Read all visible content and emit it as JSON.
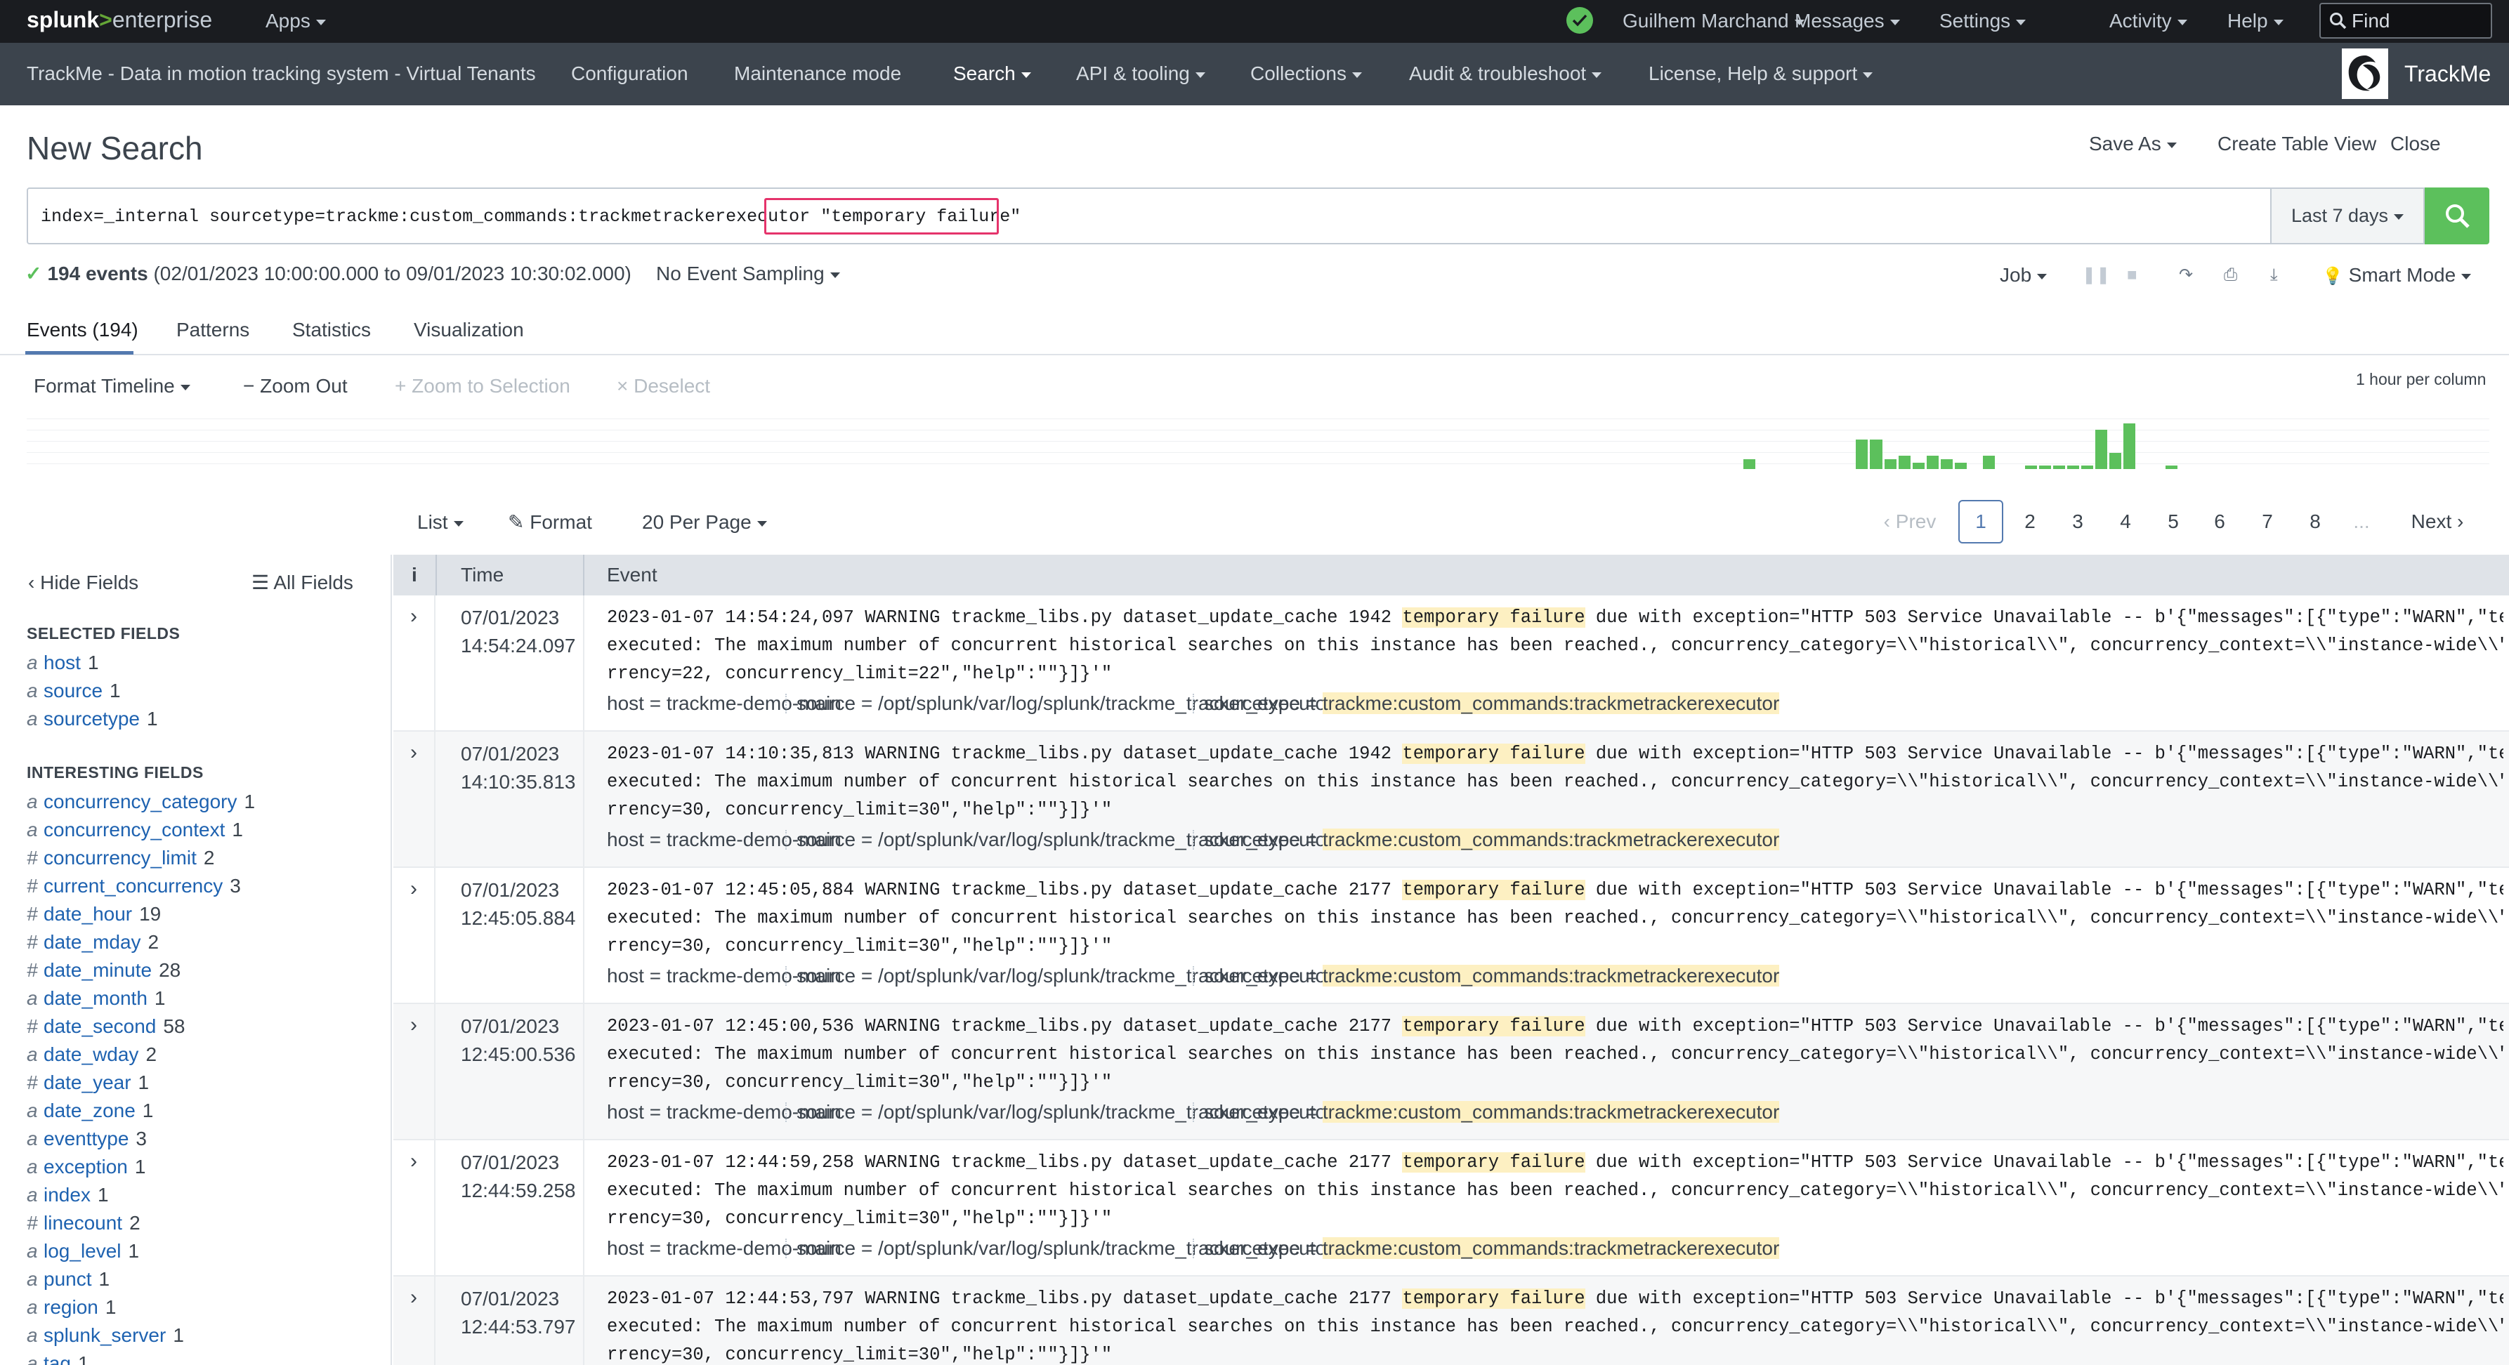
{
  "topbar": {
    "logo_splunk": "splunk",
    "logo_gt": ">",
    "logo_enterprise": "enterprise",
    "apps": "Apps",
    "user": "Guilhem Marchand",
    "messages": "Messages",
    "settings": "Settings",
    "activity": "Activity",
    "help": "Help",
    "find_placeholder": "Find",
    "status_color": "#5cc05c"
  },
  "appbar": {
    "title": "TrackMe - Data in motion tracking system - Virtual Tenants",
    "configuration": "Configuration",
    "maintenance": "Maintenance mode",
    "search": "Search",
    "api": "API & tooling",
    "collections": "Collections",
    "audit": "Audit & troubleshoot",
    "license": "License, Help & support",
    "brand": "TrackMe"
  },
  "header": {
    "title": "New Search",
    "save_as": "Save As",
    "create_table_view": "Create Table View",
    "close": "Close"
  },
  "search": {
    "query": "index=_internal sourcetype=trackme:custom_commands:trackmetrackerexecutor",
    "query_highlight": "\"temporary failure\"",
    "time_range": "Last 7 days",
    "button_color": "#5cc05c"
  },
  "meta": {
    "count": "194 events",
    "range": "(02/01/2023 10:00:00.000 to 09/01/2023 10:30:02.000)",
    "sampling": "No Event Sampling",
    "job": "Job",
    "mode": "Smart Mode"
  },
  "tabs": [
    "Events (194)",
    "Patterns",
    "Statistics",
    "Visualization"
  ],
  "timeline": {
    "format": "Format Timeline",
    "zoom_out": "Zoom Out",
    "zoom_selection": "Zoom to Selection",
    "deselect": "Deselect",
    "scale": "1 hour per column",
    "bar_color": "#5cc05c",
    "bars": [
      {
        "col": 122,
        "count": 3
      },
      {
        "col": 130,
        "count": 9
      },
      {
        "col": 131,
        "count": 9
      },
      {
        "col": 132,
        "count": 3
      },
      {
        "col": 133,
        "count": 4
      },
      {
        "col": 134,
        "count": 2
      },
      {
        "col": 135,
        "count": 4
      },
      {
        "col": 136,
        "count": 3
      },
      {
        "col": 137,
        "count": 2
      },
      {
        "col": 139,
        "count": 4
      },
      {
        "col": 142,
        "count": 1
      },
      {
        "col": 143,
        "count": 1
      },
      {
        "col": 144,
        "count": 1
      },
      {
        "col": 145,
        "count": 1
      },
      {
        "col": 146,
        "count": 1
      },
      {
        "col": 147,
        "count": 12
      },
      {
        "col": 148,
        "count": 5
      },
      {
        "col": 149,
        "count": 14
      },
      {
        "col": 152,
        "count": 1
      }
    ],
    "total_columns": 175,
    "max_count": 15
  },
  "results": {
    "list": "List",
    "format": "Format",
    "per_page": "20 Per Page",
    "prev": "Prev",
    "next": "Next",
    "pages": [
      "1",
      "2",
      "3",
      "4",
      "5",
      "6",
      "7",
      "8"
    ],
    "ellipsis": "...",
    "current_page": "1"
  },
  "sidebar": {
    "hide_fields": "Hide Fields",
    "all_fields": "All Fields",
    "selected_title": "SELECTED FIELDS",
    "interesting_title": "INTERESTING FIELDS",
    "selected": [
      {
        "type": "a",
        "name": "host",
        "count": "1"
      },
      {
        "type": "a",
        "name": "source",
        "count": "1"
      },
      {
        "type": "a",
        "name": "sourcetype",
        "count": "1"
      }
    ],
    "interesting": [
      {
        "type": "a",
        "name": "concurrency_category",
        "count": "1"
      },
      {
        "type": "a",
        "name": "concurrency_context",
        "count": "1"
      },
      {
        "type": "#",
        "name": "concurrency_limit",
        "count": "2"
      },
      {
        "type": "#",
        "name": "current_concurrency",
        "count": "3"
      },
      {
        "type": "#",
        "name": "date_hour",
        "count": "19"
      },
      {
        "type": "#",
        "name": "date_mday",
        "count": "2"
      },
      {
        "type": "#",
        "name": "date_minute",
        "count": "28"
      },
      {
        "type": "a",
        "name": "date_month",
        "count": "1"
      },
      {
        "type": "#",
        "name": "date_second",
        "count": "58"
      },
      {
        "type": "a",
        "name": "date_wday",
        "count": "2"
      },
      {
        "type": "#",
        "name": "date_year",
        "count": "1"
      },
      {
        "type": "a",
        "name": "date_zone",
        "count": "1"
      },
      {
        "type": "a",
        "name": "eventtype",
        "count": "3"
      },
      {
        "type": "a",
        "name": "exception",
        "count": "1"
      },
      {
        "type": "a",
        "name": "index",
        "count": "1"
      },
      {
        "type": "#",
        "name": "linecount",
        "count": "2"
      },
      {
        "type": "a",
        "name": "log_level",
        "count": "1"
      },
      {
        "type": "a",
        "name": "punct",
        "count": "1"
      },
      {
        "type": "a",
        "name": "region",
        "count": "1"
      },
      {
        "type": "a",
        "name": "splunk_server",
        "count": "1"
      },
      {
        "type": "a",
        "name": "tag",
        "count": "1"
      }
    ]
  },
  "events_table": {
    "col_info": "i",
    "col_time": "Time",
    "col_event": "Event",
    "rows": [
      {
        "date": "07/01/2023",
        "time": "14:54:24.097",
        "prefix": "2023-01-07 14:54:24,097 WARNING trackme_libs.py dataset_update_cache 1942 ",
        "hl": "temporary failure",
        "suffix": " due with exception=\"HTTP 503 Service Unavailable -- b'{\"messages\":[{\"type\":\"WARN\",\"text\":\"Search not",
        "line2": "executed: The maximum number of concurrent historical searches on this instance has been reached., concurrency_category=\\\\\"historical\\\\\", concurrency_context=\\\\\"instance-wide\\\\\", current_concu",
        "line3": "rrency=22, concurrency_limit=22\",\"help\":\"\"}]}'\"",
        "host": "trackme-demo-main",
        "source": "/opt/splunk/var/log/splunk/trackme_tracker_executor.log",
        "sourcetype": "trackme:custom_commands:trackmetrackerexecutor"
      },
      {
        "date": "07/01/2023",
        "time": "14:10:35.813",
        "prefix": "2023-01-07 14:10:35,813 WARNING trackme_libs.py dataset_update_cache 1942 ",
        "hl": "temporary failure",
        "suffix": " due with exception=\"HTTP 503 Service Unavailable -- b'{\"messages\":[{\"type\":\"WARN\",\"text\":\"Search not",
        "line2": "executed: The maximum number of concurrent historical searches on this instance has been reached., concurrency_category=\\\\\"historical\\\\\", concurrency_context=\\\\\"instance-wide\\\\\", current_concu",
        "line3": "rrency=30, concurrency_limit=30\",\"help\":\"\"}]}'\"",
        "host": "trackme-demo-main",
        "source": "/opt/splunk/var/log/splunk/trackme_tracker_executor.log",
        "sourcetype": "trackme:custom_commands:trackmetrackerexecutor"
      },
      {
        "date": "07/01/2023",
        "time": "12:45:05.884",
        "prefix": "2023-01-07 12:45:05,884 WARNING trackme_libs.py dataset_update_cache 2177 ",
        "hl": "temporary failure",
        "suffix": " due with exception=\"HTTP 503 Service Unavailable -- b'{\"messages\":[{\"type\":\"WARN\",\"text\":\"Search not",
        "line2": "executed: The maximum number of concurrent historical searches on this instance has been reached., concurrency_category=\\\\\"historical\\\\\", concurrency_context=\\\\\"instance-wide\\\\\", current_concu",
        "line3": "rrency=30, concurrency_limit=30\",\"help\":\"\"}]}'\"",
        "host": "trackme-demo-main",
        "source": "/opt/splunk/var/log/splunk/trackme_tracker_executor.log",
        "sourcetype": "trackme:custom_commands:trackmetrackerexecutor"
      },
      {
        "date": "07/01/2023",
        "time": "12:45:00.536",
        "prefix": "2023-01-07 12:45:00,536 WARNING trackme_libs.py dataset_update_cache 2177 ",
        "hl": "temporary failure",
        "suffix": " due with exception=\"HTTP 503 Service Unavailable -- b'{\"messages\":[{\"type\":\"WARN\",\"text\":\"Search not",
        "line2": "executed: The maximum number of concurrent historical searches on this instance has been reached., concurrency_category=\\\\\"historical\\\\\", concurrency_context=\\\\\"instance-wide\\\\\", current_concu",
        "line3": "rrency=30, concurrency_limit=30\",\"help\":\"\"}]}'\"",
        "host": "trackme-demo-main",
        "source": "/opt/splunk/var/log/splunk/trackme_tracker_executor.log",
        "sourcetype": "trackme:custom_commands:trackmetrackerexecutor"
      },
      {
        "date": "07/01/2023",
        "time": "12:44:59.258",
        "prefix": "2023-01-07 12:44:59,258 WARNING trackme_libs.py dataset_update_cache 2177 ",
        "hl": "temporary failure",
        "suffix": " due with exception=\"HTTP 503 Service Unavailable -- b'{\"messages\":[{\"type\":\"WARN\",\"text\":\"Search not",
        "line2": "executed: The maximum number of concurrent historical searches on this instance has been reached., concurrency_category=\\\\\"historical\\\\\", concurrency_context=\\\\\"instance-wide\\\\\", current_concu",
        "line3": "rrency=30, concurrency_limit=30\",\"help\":\"\"}]}'\"",
        "host": "trackme-demo-main",
        "source": "/opt/splunk/var/log/splunk/trackme_tracker_executor.log",
        "sourcetype": "trackme:custom_commands:trackmetrackerexecutor"
      },
      {
        "date": "07/01/2023",
        "time": "12:44:53.797",
        "prefix": "2023-01-07 12:44:53,797 WARNING trackme_libs.py dataset_update_cache 2177 ",
        "hl": "temporary failure",
        "suffix": " due with exception=\"HTTP 503 Service Unavailable -- b'{\"messages\":[{\"type\":\"WARN\",\"text\":\"Search not",
        "line2": "executed: The maximum number of concurrent historical searches on this instance has been reached., concurrency_category=\\\\\"historical\\\\\", concurrency_context=\\\\\"instance-wide\\\\\", current_concu",
        "line3": "rrency=30, concurrency_limit=30\",\"help\":\"\"}]}'\"",
        "host": "trackme-demo-main",
        "source": "/opt/splunk/var/log/splunk/trackme_tracker_executor.log",
        "sourcetype": "trackme:custom_commands:trackmetrackerexecutor"
      }
    ]
  }
}
